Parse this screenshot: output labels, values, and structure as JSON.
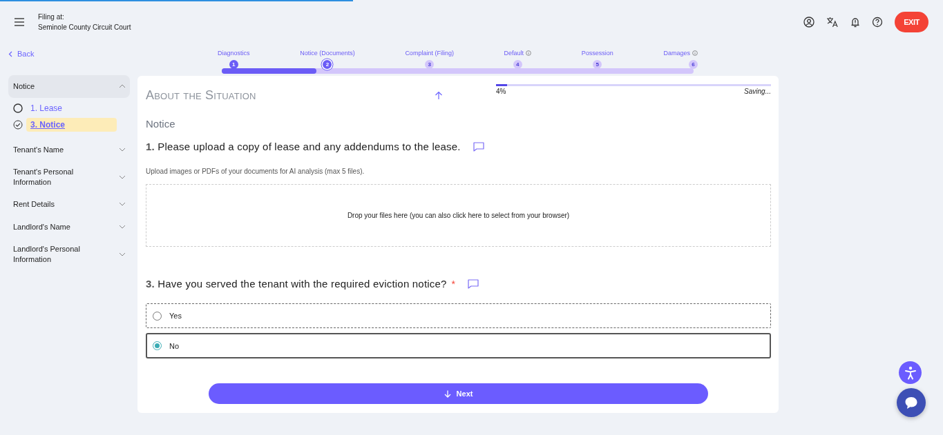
{
  "top_loader": {
    "level": 0.374
  },
  "header": {
    "filing_label": "Filing at:",
    "court": "Seminole County Circuit Court",
    "exit_label": "EXIT"
  },
  "back": {
    "label": "Back"
  },
  "stepper": [
    {
      "label": "Diagnostics",
      "number": "1",
      "completed": true,
      "selected": false,
      "info": false
    },
    {
      "label": "Notice (Documents)",
      "number": "2",
      "completed": false,
      "selected": true,
      "info": false
    },
    {
      "label": "Complaint (Filing)",
      "number": "3",
      "completed": false,
      "selected": false,
      "info": false
    },
    {
      "label": "Default",
      "number": "4",
      "completed": false,
      "selected": false,
      "info": true
    },
    {
      "label": "Possession",
      "number": "5",
      "completed": false,
      "selected": false,
      "info": false
    },
    {
      "label": "Damages",
      "number": "6",
      "completed": false,
      "selected": false,
      "info": true
    }
  ],
  "sidebar": {
    "groups": [
      {
        "title": "Notice",
        "expanded": true,
        "items": [
          {
            "label": "1. Lease",
            "checked": false,
            "selected": false
          },
          {
            "label": "3. Notice",
            "checked": true,
            "selected": true
          }
        ]
      },
      {
        "title": "Tenant's Name",
        "expanded": false
      },
      {
        "title": "Tenant's Personal Information",
        "expanded": false
      },
      {
        "title": "Rent Details",
        "expanded": false
      },
      {
        "title": "Landlord's Name",
        "expanded": false
      },
      {
        "title": "Landlord's Personal Information",
        "expanded": false
      }
    ]
  },
  "section": {
    "title": "About the Situation",
    "progress": {
      "level": 0.04,
      "reading": "4%",
      "status": "Saving..."
    },
    "subtitle": "Notice"
  },
  "questions": [
    {
      "kind": "upload",
      "number": "1.",
      "text": "Please upload a copy of lease and any addendums to the lease.",
      "required": false,
      "hint": "Upload images or PDFs of your documents for AI analysis (max 5 files).",
      "dropzone": "Drop your files here (you can also click here to select from your browser)"
    },
    {
      "kind": "radio",
      "number": "3.",
      "text": "Have you served the tenant with the required eviction notice?",
      "required": true,
      "required_mark": "*",
      "options": [
        {
          "label": "Yes",
          "selected": false
        },
        {
          "label": "No",
          "selected": true
        }
      ]
    }
  ],
  "next_button": {
    "label": "Next"
  }
}
